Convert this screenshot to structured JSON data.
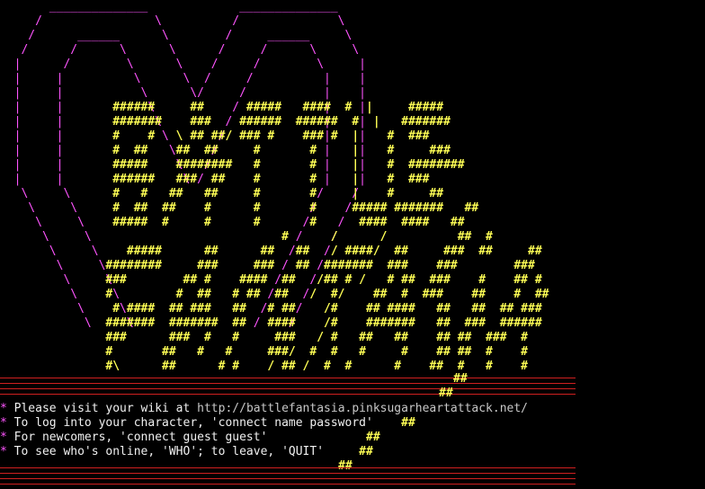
{
  "banner": {
    "heart_art": "       ______________             ______________\n     /                \\          /              \\\n    /      ______      \\        /     ______     \\\n   /      /      \\      \\      /     /      \\     \\\n  |      /        \\      \\    /     /        \\     |\n  |     |          \\      \\  /     /          |    |\n  |     |           \\      \\/     /           |    |\n  |     |            \\           /            |    |\n  |     |             \\         /             |    |\n  |     |              \\       /              |    |\n  |     |               \\     /               |    |\n  |     |                \\   /                |    |\n  |     |                 \\ /                 |    |\n   \\     \\                                   /    /\n    \\     \\                                 /    /\n     \\     \\                               /    /\n      \\     \\                             /    /\n       \\     \\                           /    /\n        \\     \\                         /    /\n         \\     \\                       /    /\n          \\     \\                     /    /\n           \\     \\                   /    /\n            \\     \\                 /    /",
    "title_art": "\n\n\n\n\n\n\n                ######     ##      #####   ####  #  |     #####\n                #######    ###    ######  ######  #  |   #######\n                #    #   \\ ## ##/ ### #    ### #  |    #  ###\n                #  ##    ##  ##     #       #     |    #     ###\n                #####    ########   #       #     |    #  ########\n                ######   ###  ##    #       #     |    #  ###\n                #   #   ##   ##     #       #     |    #     ##\n                #  ##  ##    #      #       #     ##### #######   ##\n                #####  #     #      #       #      ####  ####   ##\n                                        #      /      /          ##  #\n                  #####      ##      ##   ##   / ####/  ##     ###  ##     ##\n               ########     ###     ###   ##  #######  ###    ###        ###\n               ###        ## #    ####  ##   /## # /   # ##  ###    #    ## #\n               #         #  ##   # ##  ##   /  #/    ##  #  ###    ##    #  ##\n                # ####  ## ###   ##   # ##    /#    ## ####   ##   ##  ## ###\n               #######  #######  ##   ####    /#    #######   ##  ###  ######\n               ###      ###  #   #     ###   / #   ##   ##    ## ##  ###  #\n               #       ##   #   #     ###/  #  #   #     #    ## ##  #    #\n               #\\      ##      # #    / ## /  #  #      #    ##  #   #    #"
  },
  "banner_hashes": [
    "##",
    "##",
    "##",
    "##"
  ],
  "messages": [
    {
      "bullet": "*",
      "text": " Please visit your wiki at ",
      "url": "http://battlefantasia.pinksugarheartattack.net/",
      "suffix": ""
    },
    {
      "bullet": "*",
      "text": " To log into your character, 'connect name password'",
      "url": "",
      "suffix": "##"
    },
    {
      "bullet": "*",
      "text": " For newcomers, 'connect guest guest'",
      "url": "",
      "suffix": "##"
    },
    {
      "bullet": "*",
      "text": " To see who's online, 'WHO'; to leave, 'QUIT'",
      "url": "",
      "suffix": "##"
    }
  ],
  "colors": {
    "background": "#000000",
    "heart": "#ff55ff",
    "title": "#ffff55",
    "rule": "#d02020",
    "text": "#f0f0f0"
  }
}
